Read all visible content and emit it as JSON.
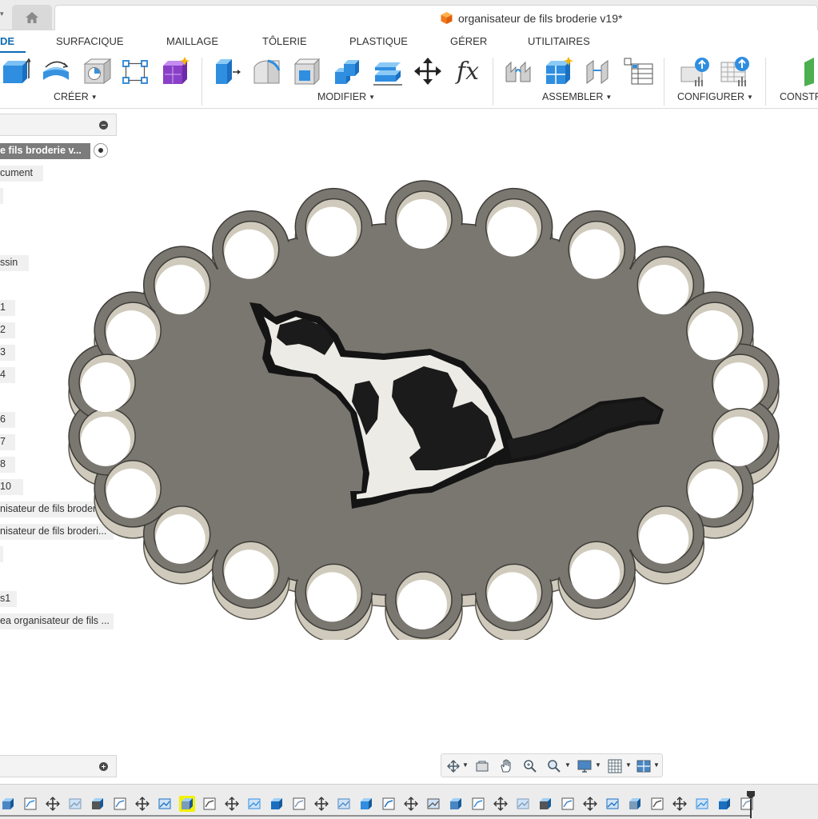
{
  "titlebar": {
    "document_title": "organisateur de fils broderie v19*"
  },
  "tabs": [
    {
      "label": "DE",
      "active": true
    },
    {
      "label": "SURFACIQUE"
    },
    {
      "label": "MAILLAGE"
    },
    {
      "label": "TÔLERIE"
    },
    {
      "label": "PLASTIQUE"
    },
    {
      "label": "GÉRER"
    },
    {
      "label": "UTILITAIRES"
    }
  ],
  "toolbar": {
    "groups": [
      {
        "label": "CRÉER"
      },
      {
        "label": "MODIFIER"
      },
      {
        "label": "ASSEMBLER"
      },
      {
        "label": "CONFIGURER"
      },
      {
        "label": "CONSTR"
      }
    ],
    "fx_label": "fx"
  },
  "browser": {
    "items": [
      {
        "label": "e fils broderie v..."
      },
      {
        "label": "cument"
      },
      {
        "label": ""
      },
      {
        "label": "ssin"
      },
      {
        "label": "1"
      },
      {
        "label": "2"
      },
      {
        "label": "3"
      },
      {
        "label": "4"
      },
      {
        "label": "6"
      },
      {
        "label": "7"
      },
      {
        "label": "8"
      },
      {
        "label": "10"
      },
      {
        "label": "nisateur de fils broder..."
      },
      {
        "label": "nisateur de fils broderi..."
      },
      {
        "label": ""
      },
      {
        "label": "s1"
      },
      {
        "label": "ea organisateur de fils ..."
      }
    ]
  },
  "colors": {
    "accent": "#0f6ab4",
    "plate": "#7a7771",
    "plate_edge": "#cfcabc",
    "cat_white": "#ecebe6",
    "cat_black": "#1b1b1b",
    "timeline_highlight": "#f2f200"
  },
  "icons": {
    "home": "home-icon",
    "document": "box-icon"
  }
}
